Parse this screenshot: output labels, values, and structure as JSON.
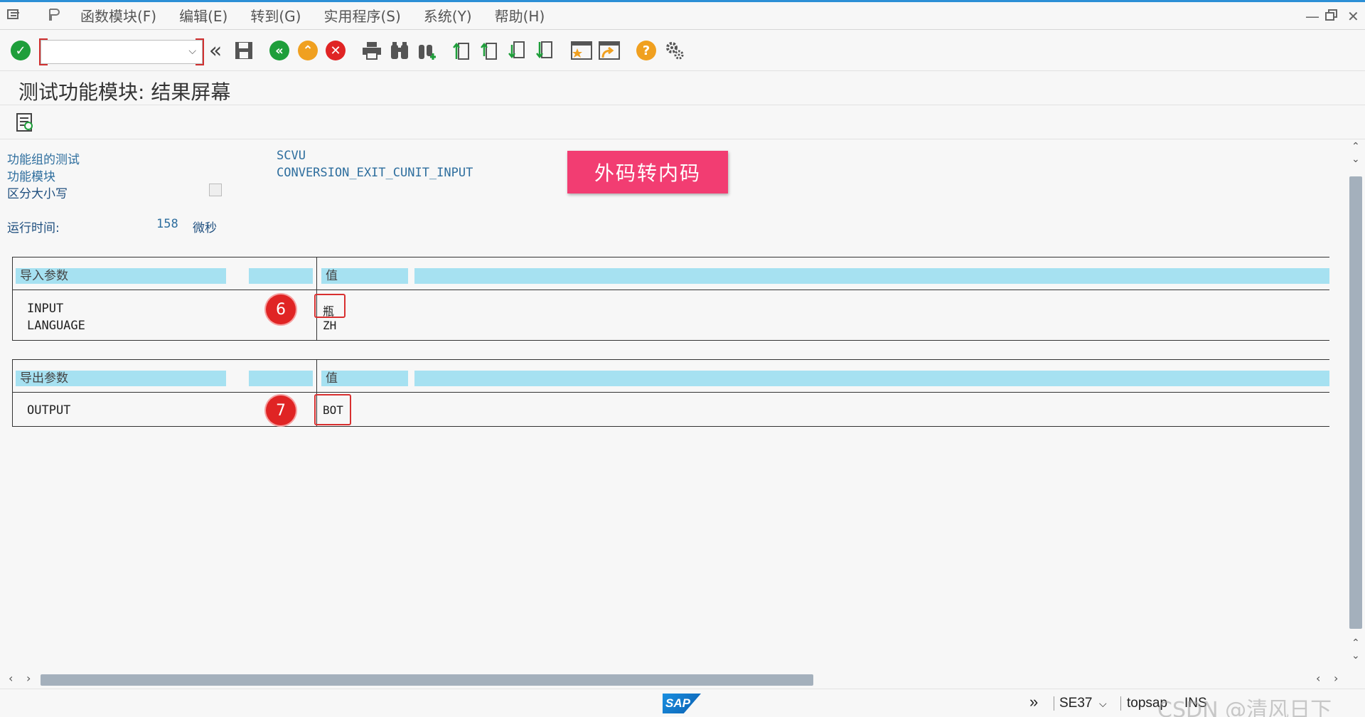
{
  "menu": {
    "items": [
      "函数模块(F)",
      "编辑(E)",
      "转到(G)",
      "实用程序(S)",
      "系统(Y)",
      "帮助(H)"
    ]
  },
  "toolbar": {
    "command_field_value": "",
    "icons": [
      "enter-icon",
      "back-double-icon",
      "save-icon",
      "back-icon",
      "exit-icon",
      "cancel-icon",
      "print-icon",
      "find-icon",
      "find-next-icon",
      "first-page-icon",
      "previous-page-icon",
      "next-page-icon",
      "last-page-icon",
      "create-session-icon",
      "shortcut-icon",
      "help-icon",
      "settings-icon"
    ]
  },
  "page": {
    "title": "测试功能模块: 结果屏幕"
  },
  "info": {
    "group_label": "功能组的测试",
    "group_value": "SCVU",
    "fm_label": "功能模块",
    "fm_value": "CONVERSION_EXIT_CUNIT_INPUT",
    "case_label": "区分大小写",
    "runtime_label": "运行时间:",
    "runtime_value": "158",
    "runtime_unit": "微秒"
  },
  "banner": {
    "text": "外码转内码",
    "color": "#f23d72"
  },
  "import_params": {
    "header": "导入参数",
    "value_header": "值",
    "rows": [
      {
        "name": "INPUT",
        "value": "瓶"
      },
      {
        "name": "LANGUAGE",
        "value": "ZH"
      }
    ],
    "marker": "6"
  },
  "export_params": {
    "header": "导出参数",
    "value_header": "值",
    "rows": [
      {
        "name": "OUTPUT",
        "value": "BOT"
      }
    ],
    "marker": "7"
  },
  "status": {
    "transaction": "SE37",
    "user": "topsap",
    "mode": "INS",
    "watermark": "CSDN @清风日下"
  }
}
